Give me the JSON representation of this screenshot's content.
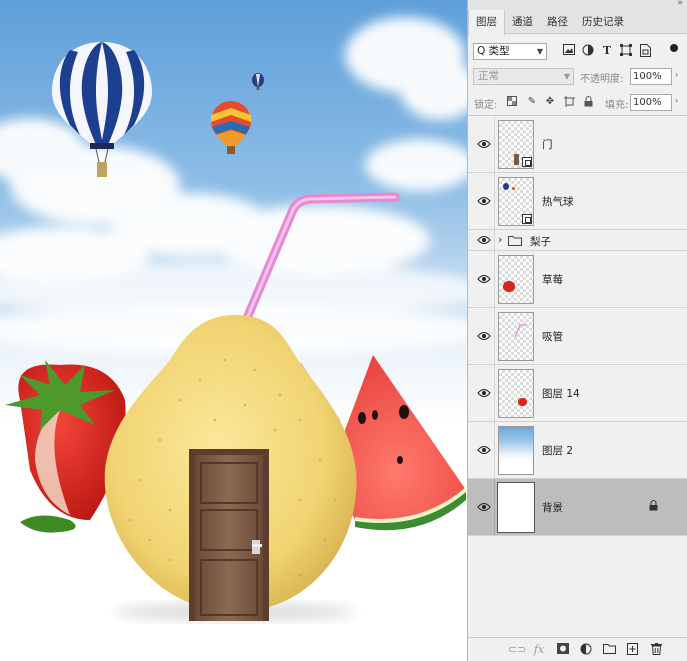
{
  "panel": {
    "collapse_glyph": "»",
    "tabs": [
      {
        "label": "图层",
        "active": true
      },
      {
        "label": "通道",
        "active": false
      },
      {
        "label": "路径",
        "active": false
      },
      {
        "label": "历史记录",
        "active": false
      }
    ],
    "filter": {
      "kind_label": "Q 类型",
      "icons": [
        "image-filter-icon",
        "adjustment-filter-icon",
        "type-filter-icon",
        "shape-filter-icon",
        "smart-object-filter-icon"
      ]
    },
    "blend_mode": "正常",
    "opacity_label": "不透明度:",
    "opacity_value": "100%",
    "lock_label": "锁定:",
    "lock_icons": [
      "lock-transparent-pixels-icon",
      "lock-image-pixels-icon",
      "lock-position-icon",
      "lock-artboard-icon",
      "lock-all-icon"
    ],
    "fill_label": "填充:",
    "fill_value": "100%",
    "layers": [
      {
        "name": "门",
        "type": "smart-object",
        "visible": true,
        "selected": false,
        "thumb": "door"
      },
      {
        "name": "热气球",
        "type": "smart-object",
        "visible": true,
        "selected": false,
        "thumb": "balloon"
      },
      {
        "name": "梨子",
        "type": "group",
        "visible": true,
        "selected": false,
        "collapsed_glyph": "›"
      },
      {
        "name": "草莓",
        "type": "pixel",
        "visible": true,
        "selected": false,
        "thumb": "strawberry"
      },
      {
        "name": "吸管",
        "type": "pixel",
        "visible": true,
        "selected": false,
        "thumb": "straw"
      },
      {
        "name": "图层 14",
        "type": "pixel",
        "visible": true,
        "selected": false,
        "thumb": "small-strawberry"
      },
      {
        "name": "图层 2",
        "type": "pixel",
        "visible": true,
        "selected": false,
        "thumb": "sky"
      },
      {
        "name": "背景",
        "type": "background",
        "visible": true,
        "selected": true,
        "locked": true,
        "thumb": "white"
      }
    ],
    "bottom_icons": [
      "link-layers-icon",
      "fx-icon",
      "add-mask-icon",
      "adjustment-layer-icon",
      "new-group-icon",
      "new-layer-icon",
      "delete-layer-icon"
    ],
    "fx_label": "fx"
  },
  "colors": {
    "panel_bg": "#f0f0f0",
    "selected_layer": "#bdbdbd",
    "straw_pink": "#e58ad0",
    "pear_yellow": "#f3d879",
    "door_brown": "#7a5a45",
    "strawberry_red": "#d8261e",
    "watermelon_red": "#ee5a56"
  }
}
